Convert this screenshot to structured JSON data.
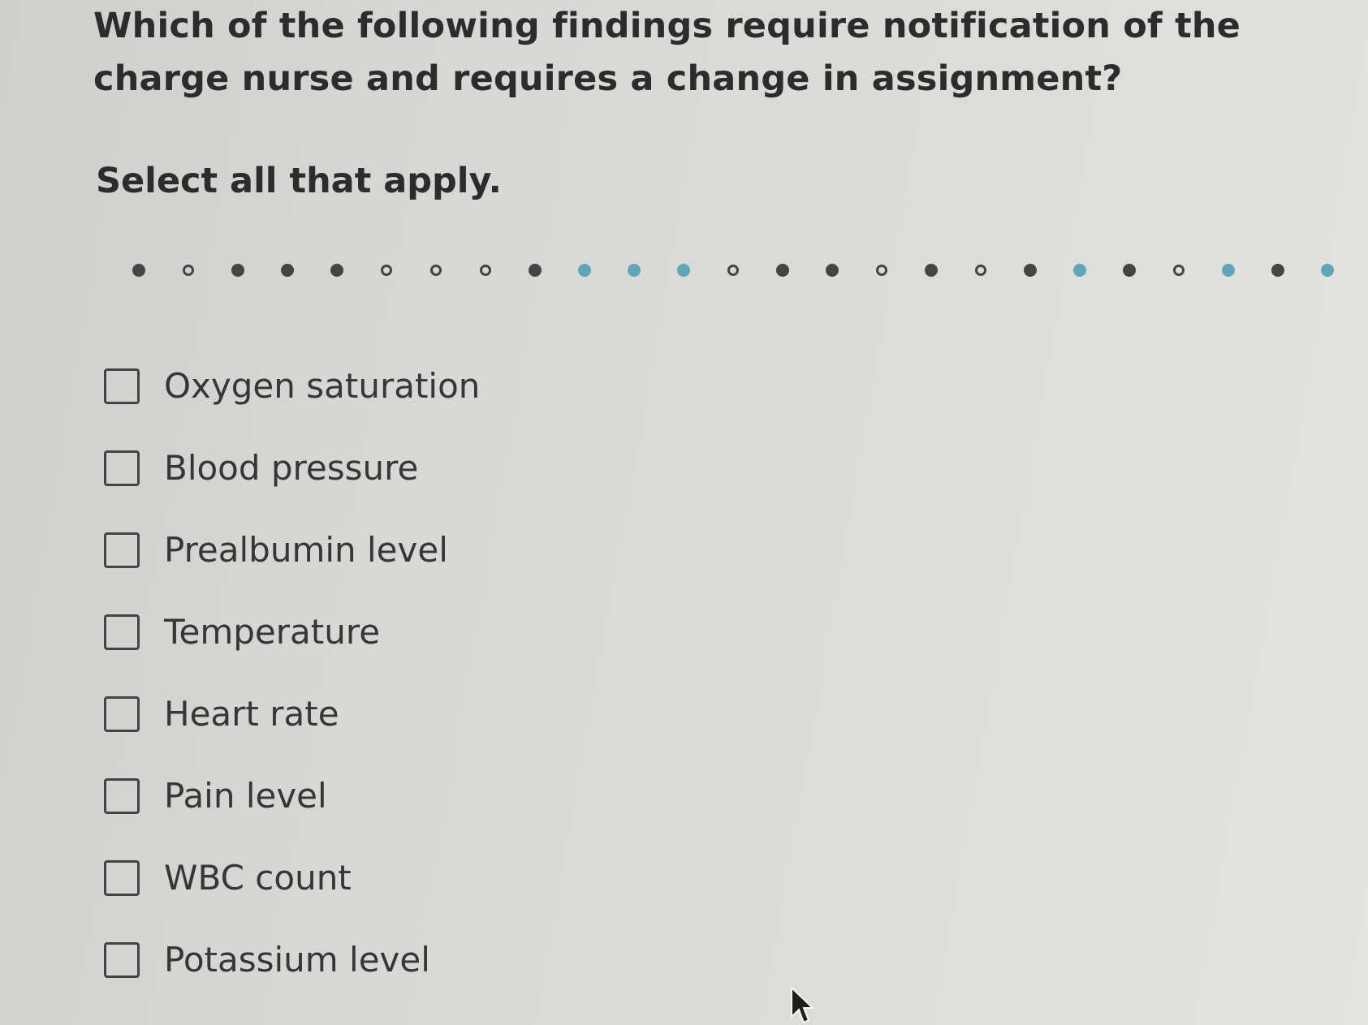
{
  "question": {
    "text": "Which of the following findings require notification of the charge nurse and requires a change in assignment?",
    "instruction": "Select all that apply."
  },
  "progress": {
    "states": [
      "filled",
      "open",
      "filled",
      "filled",
      "filled",
      "open",
      "open",
      "open",
      "filled",
      "current",
      "current",
      "current",
      "open",
      "filled",
      "filled",
      "open",
      "filled",
      "open",
      "filled",
      "current",
      "filled",
      "open",
      "current",
      "filled",
      "current"
    ]
  },
  "options": [
    {
      "label": "Oxygen saturation",
      "checked": false
    },
    {
      "label": "Blood pressure",
      "checked": false
    },
    {
      "label": "Prealbumin level",
      "checked": false
    },
    {
      "label": "Temperature",
      "checked": false
    },
    {
      "label": "Heart rate",
      "checked": false
    },
    {
      "label": "Pain level",
      "checked": false
    },
    {
      "label": "WBC count",
      "checked": false
    },
    {
      "label": "Potassium level",
      "checked": false
    }
  ],
  "colors": {
    "dot_filled": "#444444",
    "dot_current": "#5fa6b8",
    "text": "#2c2c2c"
  },
  "icons": {
    "cursor": "mouse-pointer-icon"
  }
}
